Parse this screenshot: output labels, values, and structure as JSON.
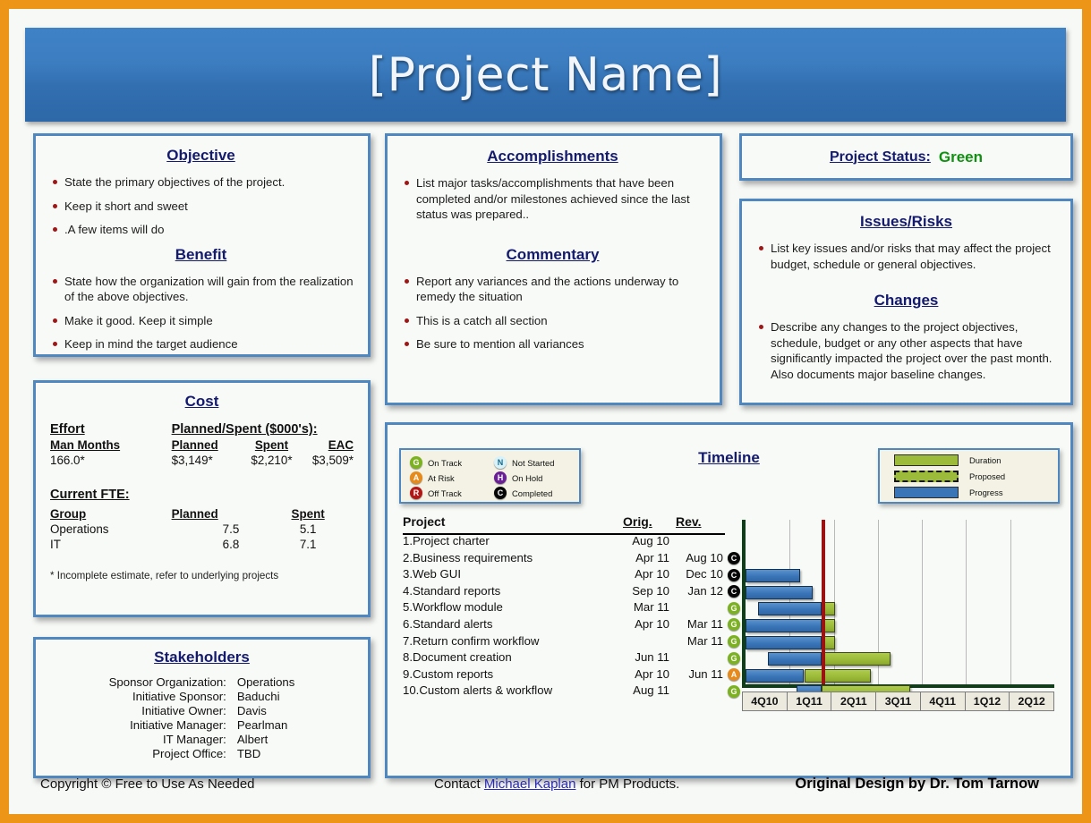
{
  "header": {
    "title": "[Project Name]"
  },
  "objective": {
    "heading": "Objective",
    "items": [
      "State the primary objectives of the project.",
      "Keep it short and sweet",
      ".A few items will do"
    ],
    "benefit_heading": "Benefit",
    "benefit_items": [
      "State how the organization will gain from the realization of the above objectives.",
      "Make it good. Keep it simple",
      "Keep in mind the target audience"
    ]
  },
  "cost": {
    "heading": "Cost",
    "effort_label": "Effort",
    "planned_spent_label": "Planned/Spent ($000's):",
    "columns": [
      "Man Months",
      "Planned",
      "Spent",
      "EAC"
    ],
    "values": [
      "166.0*",
      "$3,149*",
      "$2,210*",
      "$3,509*"
    ],
    "fte_label": "Current FTE:",
    "fte_columns": [
      "Group",
      "Planned",
      "Spent"
    ],
    "fte_rows": [
      {
        "group": "Operations",
        "planned": "7.5",
        "spent": "5.1"
      },
      {
        "group": "IT",
        "planned": "6.8",
        "spent": "7.1"
      }
    ],
    "footnote": "* Incomplete estimate, refer to underlying projects"
  },
  "stakeholders": {
    "heading": "Stakeholders",
    "rows": [
      {
        "key": "Sponsor Organization:",
        "value": "Operations"
      },
      {
        "key": "Initiative Sponsor:",
        "value": "Baduchi"
      },
      {
        "key": "Initiative Owner:",
        "value": "Davis"
      },
      {
        "key": "Initiative Manager:",
        "value": "Pearlman"
      },
      {
        "key": "IT Manager:",
        "value": "Albert"
      },
      {
        "key": "Project Office:",
        "value": "TBD"
      }
    ]
  },
  "accomplishments": {
    "heading": "Accomplishments",
    "items": [
      "List major tasks/accomplishments that have been completed and/or milestones achieved since the last status was prepared.."
    ],
    "commentary_heading": "Commentary",
    "commentary_items": [
      "Report any variances and the actions underway to remedy the situation",
      "This is a catch all section",
      "Be sure to mention all variances"
    ]
  },
  "project_status": {
    "label": "Project Status:",
    "value": "Green",
    "color": "#119111"
  },
  "issues": {
    "heading": "Issues/Risks",
    "items": [
      "List key issues and/or risks that may affect the project budget, schedule or general objectives."
    ],
    "changes_heading": "Changes",
    "changes_items": [
      "Describe any changes to the project objectives, schedule, budget or any other aspects that have significantly impacted the project over the past month. Also documents major baseline changes."
    ]
  },
  "timeline": {
    "heading": "Timeline",
    "status_legend": [
      {
        "code": "G",
        "label": "On Track",
        "color": "#7cb221"
      },
      {
        "code": "N",
        "label": "Not Started",
        "color": "#d8f2fa",
        "text_color": "#1b6a8a"
      },
      {
        "code": "A",
        "label": "At Risk",
        "color": "#e58a1b"
      },
      {
        "code": "H",
        "label": "On Hold",
        "color": "#6a1f96"
      },
      {
        "code": "R",
        "label": "Off Track",
        "color": "#b01818"
      },
      {
        "code": "C",
        "label": "Completed",
        "color": "#060606"
      }
    ],
    "bar_legend": [
      {
        "label": "Duration",
        "style": "duration"
      },
      {
        "label": "Proposed",
        "style": "proposed"
      },
      {
        "label": "Progress",
        "style": "progress"
      }
    ],
    "table_headers": {
      "project": "Project",
      "orig": "Orig.",
      "rev": "Rev."
    }
  },
  "chart_data": {
    "type": "bar",
    "title": "Timeline",
    "xlabel": "",
    "ylabel": "",
    "categories": [
      "1.Project charter",
      "2.Business requirements",
      "3.Web GUI",
      "4.Standard reports",
      "5.Workflow module",
      "6.Standard alerts",
      "7.Return confirm workflow",
      "8.Document creation",
      "9.Custom reports",
      "10.Custom alerts & workflow"
    ],
    "tick_labels": [
      "4Q10",
      "1Q11",
      "2Q11",
      "3Q11",
      "4Q11",
      "1Q12",
      "2Q12"
    ],
    "xlim": [
      0,
      7
    ],
    "grid": true,
    "legend_position": "top-right",
    "today_marker": 1.72,
    "rows": [
      {
        "name": "1.Project charter",
        "orig": "Aug 10",
        "rev": "",
        "status": "",
        "progress": null,
        "duration": null
      },
      {
        "name": "2.Business requirements",
        "orig": "Apr 11",
        "rev": "Aug 10",
        "status": "C",
        "progress": null,
        "duration": null
      },
      {
        "name": "3.Web GUI",
        "orig": "Apr 10",
        "rev": "Dec 10",
        "status": "C",
        "progress": [
          0.0,
          1.23
        ],
        "duration": null
      },
      {
        "name": "4.Standard reports",
        "orig": "Sep 10",
        "rev": "Jan 12",
        "status": "C",
        "progress": [
          0.0,
          1.53
        ],
        "duration": null
      },
      {
        "name": "5.Workflow module",
        "orig": "Mar 11",
        "rev": "",
        "status": "G",
        "progress": [
          0.29,
          1.72
        ],
        "duration": [
          1.72,
          2.02
        ]
      },
      {
        "name": "6.Standard alerts",
        "orig": "Apr 10",
        "rev": "Mar 11",
        "status": "G",
        "progress": [
          0.0,
          1.72
        ],
        "duration": [
          1.72,
          2.02
        ]
      },
      {
        "name": "7.Return confirm workflow",
        "orig": "",
        "rev": "Mar 11",
        "status": "G",
        "progress": [
          0.0,
          1.72
        ],
        "duration": [
          1.72,
          2.02
        ]
      },
      {
        "name": "8.Document creation",
        "orig": "Jun 11",
        "rev": "",
        "status": "G",
        "progress": [
          0.51,
          1.72
        ],
        "duration": [
          1.72,
          3.28
        ]
      },
      {
        "name": "9.Custom reports",
        "orig": "Apr 10",
        "rev": "Jun 11",
        "status": "A",
        "progress": [
          0.0,
          1.32
        ],
        "duration": [
          1.34,
          2.85
        ]
      },
      {
        "name": "10.Custom alerts & workflow",
        "orig": "Aug 11",
        "rev": "",
        "status": "G",
        "progress": [
          1.15,
          1.72
        ],
        "duration": [
          1.72,
          3.74
        ]
      }
    ]
  },
  "footer": {
    "copyright": "Copyright © Free to Use As Needed",
    "contact_prefix": "Contact ",
    "contact_link": "Michael Kaplan",
    "contact_suffix": " for PM Products.",
    "design": "Original Design by Dr. Tom Tarnow"
  }
}
